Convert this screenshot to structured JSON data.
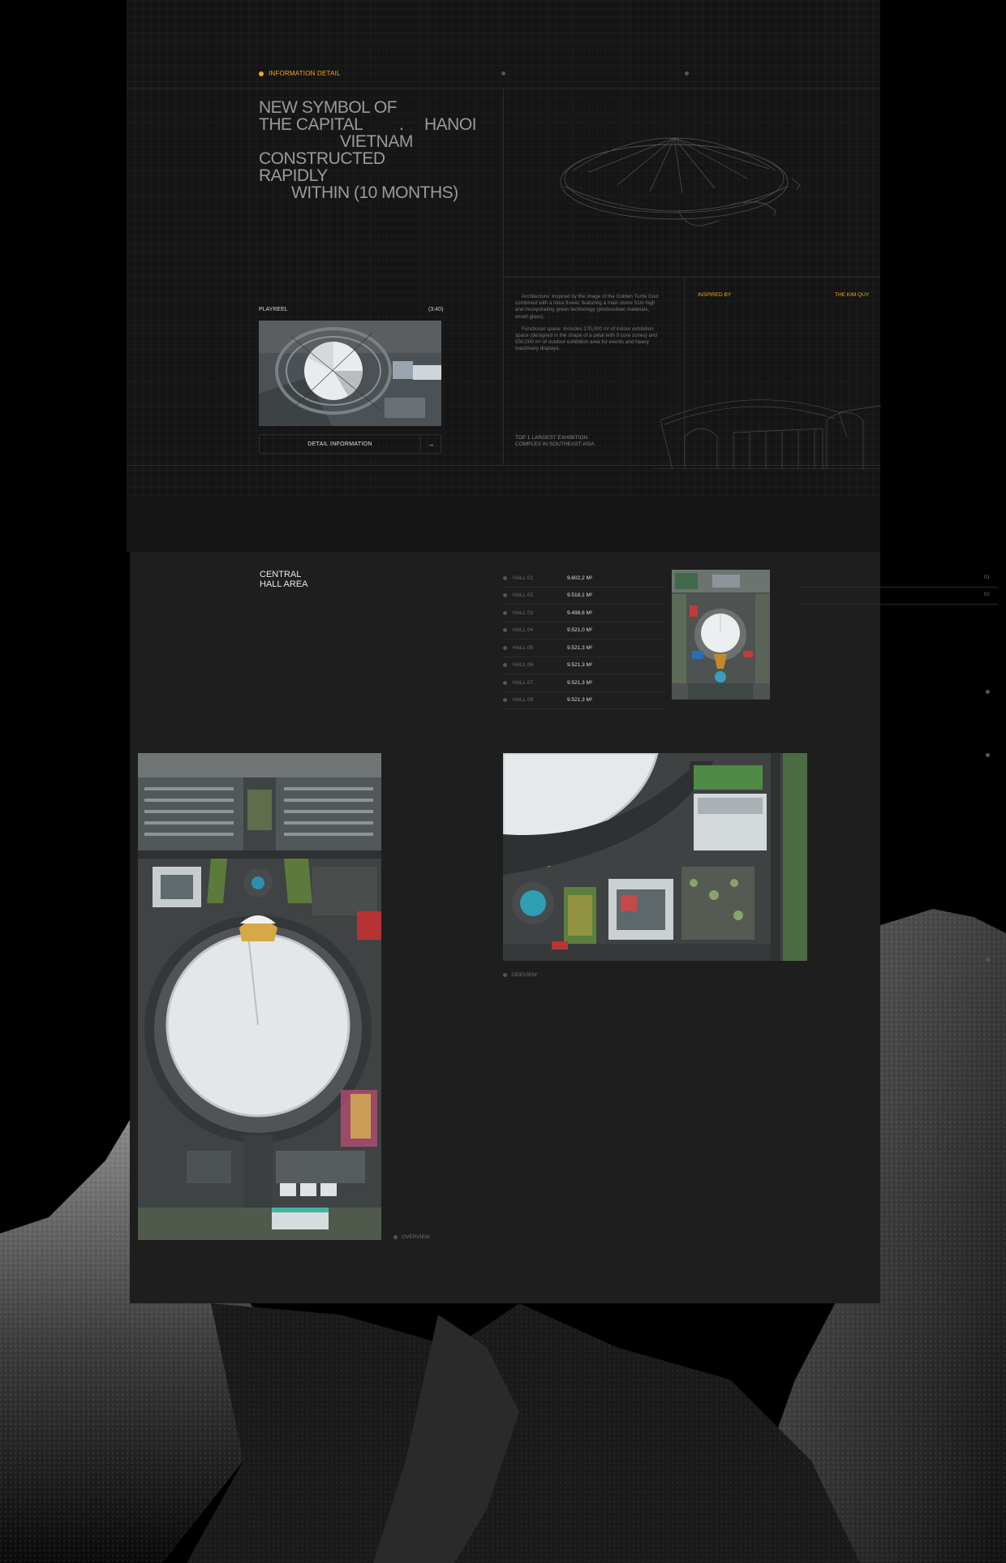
{
  "info": {
    "tag": "INFORMATION DETAIL",
    "headline": {
      "line1": "NEW SYMBOL OF",
      "line2": "THE CAPITAL",
      "dot": ".",
      "city": "HANOI",
      "country": "VIETNAM",
      "line4": "CONSTRUCTED",
      "line5": "RAPIDLY",
      "line6": "WITHIN (10 MONTHS)"
    },
    "playreel_label": "PLAYREEL",
    "playreel_duration": "(3:40)",
    "detail_button": "DETAIL INFORMATION",
    "description": [
      "Architecture: Inspired by the image of the Golden Turtle God combined with a lotus flower, featuring a main dome 51m high and incorporating green technology (photovoltaic materials, smart glass).",
      "Functional space: Includes 170,000 m² of indoor exhibition space (designed in the shape of a petal with 9 core zones) and 550,000 m² of outdoor exhibition area for events and heavy machinery displays."
    ],
    "inspired_label": "INSPIRED BY",
    "inspired_value": "THE KIM QUY",
    "top_largest": "TOP 1 LARGEST EXHIBITION COMPLEX IN SOUTHEAST ASIA"
  },
  "central": {
    "title_line1": "CENTRAL",
    "title_line2": "HALL AREA",
    "halls": [
      {
        "name": "HALL 01",
        "area": "9.602,2 M²"
      },
      {
        "name": "HALL 02",
        "area": "9.518,1 M²"
      },
      {
        "name": "HALL 03",
        "area": "9.498,6 M²"
      },
      {
        "name": "HALL 04",
        "area": "9.521,0 M²"
      },
      {
        "name": "HALL 05",
        "area": "9.521,3 M²"
      },
      {
        "name": "HALL 06",
        "area": "9.521,3 M²"
      },
      {
        "name": "HALL 07",
        "area": "9.521,3 M²"
      },
      {
        "name": "HALL 08",
        "area": "9.521,3 M²"
      }
    ],
    "pages": [
      "01",
      "02"
    ],
    "overview_label": "OVERVIEW",
    "sideview_label": "SIDEVIEW"
  },
  "colors": {
    "accent": "#f0a818",
    "panel_dark": "#151515",
    "panel_mid": "#1e1e1e"
  }
}
